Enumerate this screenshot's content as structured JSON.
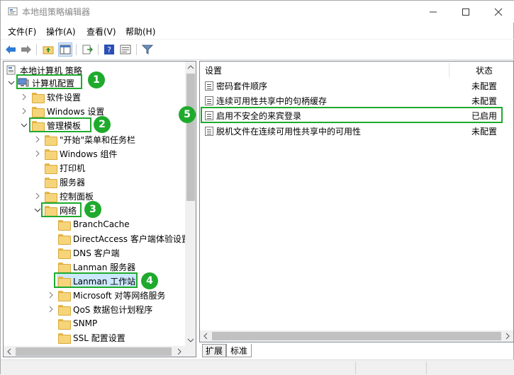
{
  "window": {
    "title": "本地组策略编辑器",
    "controls": {
      "minimize": "─",
      "maximize": "☐",
      "close": "✕"
    }
  },
  "menu": [
    "文件(F)",
    "操作(A)",
    "查看(V)",
    "帮助(H)"
  ],
  "toolbar": {
    "icons": [
      "back-arrow-icon",
      "forward-arrow-icon",
      "up-folder-icon",
      "show-hide-tree-icon",
      "export-list-icon",
      "help-icon",
      "properties-icon",
      "filter-icon"
    ]
  },
  "tree": {
    "root": "本地计算机 策略",
    "items": [
      {
        "label": "计算机配置",
        "expanded": true
      },
      {
        "label": "软件设置"
      },
      {
        "label": "Windows 设置"
      },
      {
        "label": "管理模板",
        "expanded": true
      },
      {
        "label": "\"开始\"菜单和任务栏"
      },
      {
        "label": "Windows 组件"
      },
      {
        "label": "打印机"
      },
      {
        "label": "服务器"
      },
      {
        "label": "控制面板"
      },
      {
        "label": "网络",
        "expanded": true
      },
      {
        "label": "BranchCache"
      },
      {
        "label": "DirectAccess 客户端体验设置"
      },
      {
        "label": "DNS 客户端"
      },
      {
        "label": "Lanman 服务器"
      },
      {
        "label": "Lanman 工作站",
        "selected": true
      },
      {
        "label": "Microsoft 对等网络服务"
      },
      {
        "label": "QoS 数据包计划程序"
      },
      {
        "label": "SNMP"
      },
      {
        "label": "SSL 配置设置"
      }
    ]
  },
  "list": {
    "columns": {
      "setting": "设置",
      "state": "状态"
    },
    "rows": [
      {
        "name": "密码套件顺序",
        "state": "未配置"
      },
      {
        "name": "连续可用性共享中的句柄缓存",
        "state": "未配置"
      },
      {
        "name": "启用不安全的来宾登录",
        "state": "已启用"
      },
      {
        "name": "脱机文件在连续可用性共享中的可用性",
        "state": "未配置"
      }
    ]
  },
  "tabs": [
    "扩展",
    "标准"
  ],
  "annotations": [
    "1",
    "2",
    "3",
    "4",
    "5"
  ],
  "colors": {
    "highlight": "#1faa2d",
    "selection": "#cce8ff"
  }
}
